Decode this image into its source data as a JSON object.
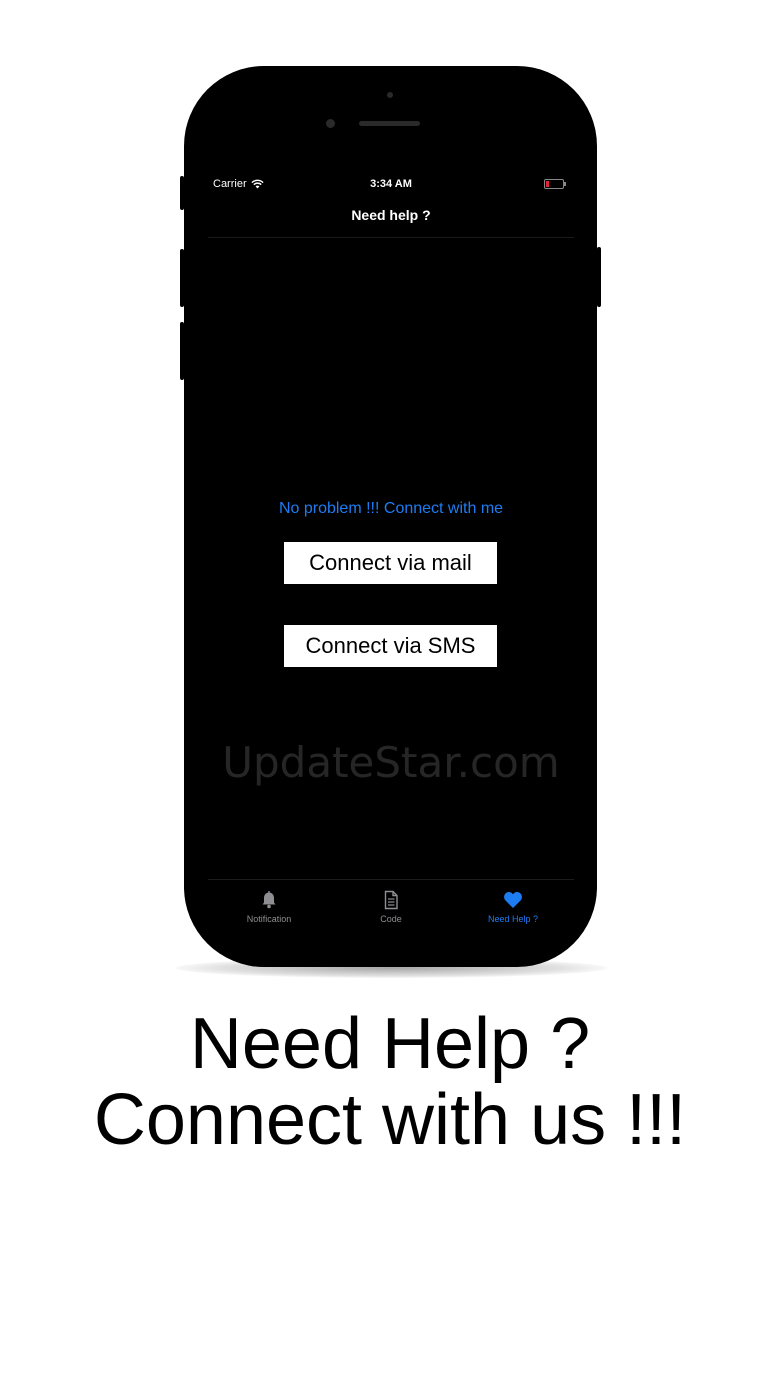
{
  "status_bar": {
    "carrier": "Carrier",
    "time": "3:34 AM",
    "battery_color": "#e0243a"
  },
  "nav": {
    "title": "Need help ?"
  },
  "content": {
    "prompt": "No problem !!! Connect with me",
    "mail_button": "Connect via mail",
    "sms_button": "Connect via SMS",
    "watermark": "UpdateStar.com"
  },
  "tabbar": {
    "tabs": [
      {
        "label": "Notification",
        "icon": "bell-icon",
        "active": false
      },
      {
        "label": "Code",
        "icon": "document-icon",
        "active": false
      },
      {
        "label": "Need Help ?",
        "icon": "heart-icon",
        "active": true
      }
    ]
  },
  "headline": {
    "line1": "Need Help ?",
    "line2": "Connect with us !!!"
  },
  "colors": {
    "accent": "#1e7cf2",
    "inactive": "#8e8e93"
  }
}
